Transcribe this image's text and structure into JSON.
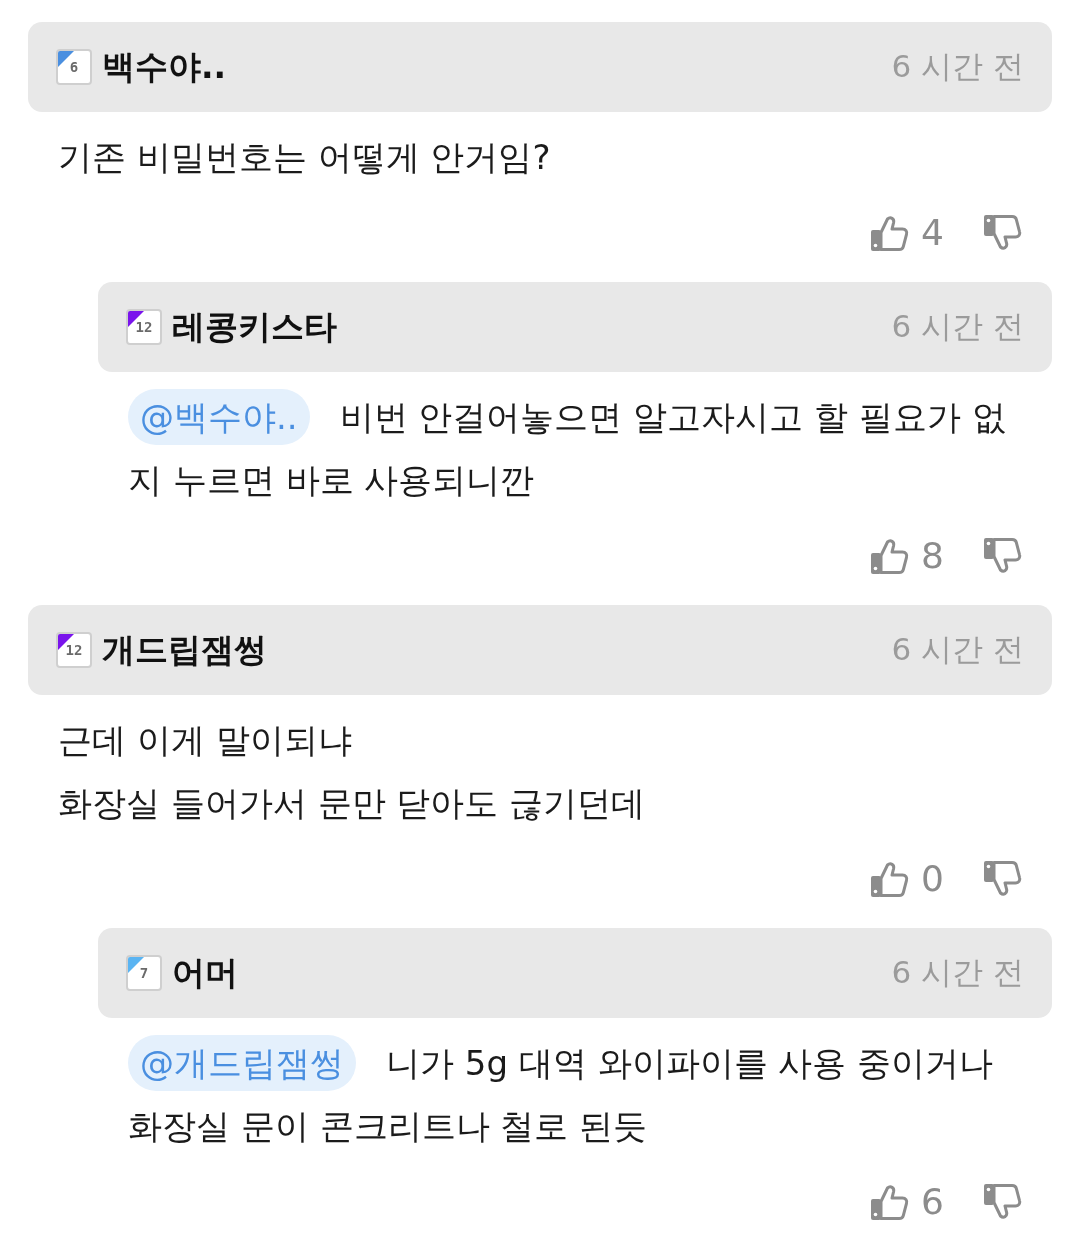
{
  "comments": [
    {
      "author": "백수야..",
      "level": {
        "label": "6",
        "color": "#4a8fe0"
      },
      "time": "6 시간 전",
      "body": "기존 비밀번호는 어떻게 안거임?",
      "likes": "4",
      "children": [
        {
          "author": "레콩키스타",
          "level": {
            "label": "12",
            "color": "#7a14ec"
          },
          "time": "6 시간 전",
          "mention": "@백수야..",
          "body": "비번 안걸어놓으면 알고자시고 할 필요가 없지 누르면 바로 사용되니깐",
          "likes": "8"
        }
      ]
    },
    {
      "author": "개드립잼썽",
      "level": {
        "label": "12",
        "color": "#7a14ec"
      },
      "time": "6 시간 전",
      "body": "근데 이게 말이되냐\n화장실 들어가서 문만 닫아도 귾기던데",
      "likes": "0",
      "children": [
        {
          "author": "어머",
          "level": {
            "label": "7",
            "color": "#5ab4f2"
          },
          "time": "6 시간 전",
          "mention": "@개드립잼썽",
          "body": "니가 5g 대역 와이파이를 사용 중이거나 화장실 문이 콘크리트나 철로 된듯",
          "likes": "6"
        }
      ]
    }
  ]
}
